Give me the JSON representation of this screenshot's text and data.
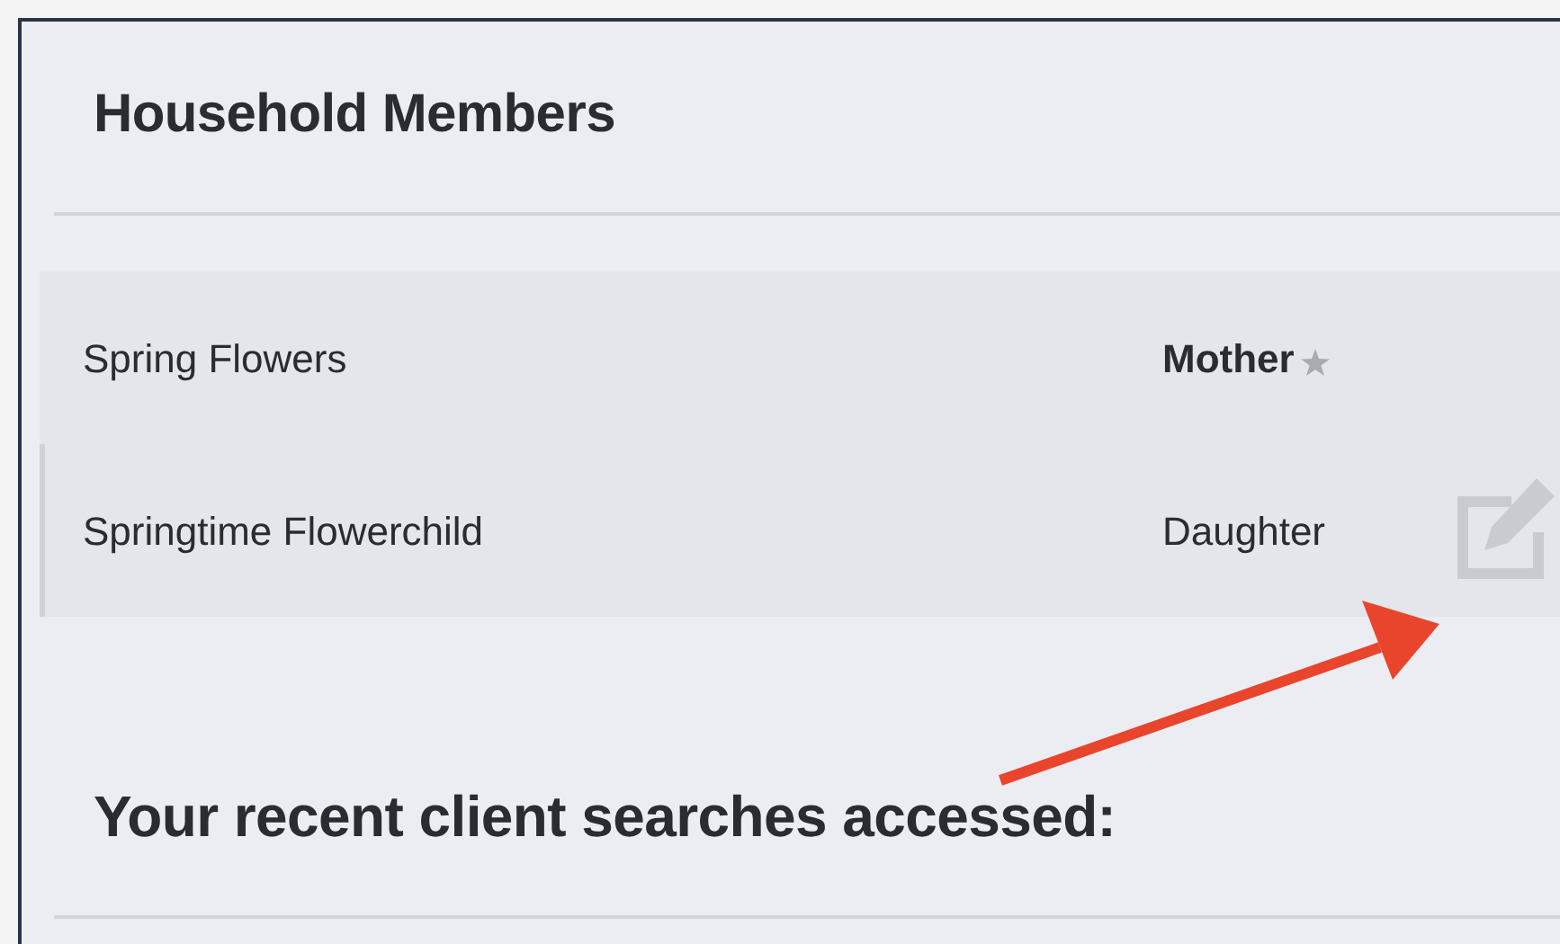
{
  "title": "Household Members",
  "members": [
    {
      "name": "Spring Flowers",
      "relation": "Mother",
      "primary": true,
      "selected": false
    },
    {
      "name": "Springtime Flowerchild",
      "relation": "Daughter",
      "primary": false,
      "selected": true
    }
  ],
  "recent_heading": "Your recent client searches accessed:"
}
